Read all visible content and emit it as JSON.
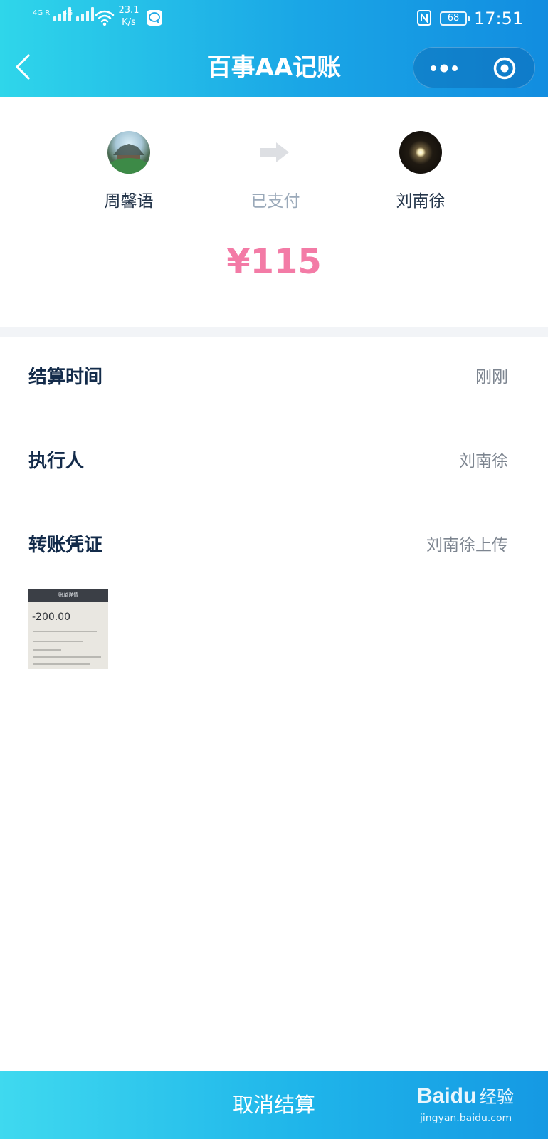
{
  "status_bar": {
    "signal_1_label": "4G R",
    "signal_2_label": "4G",
    "net_speed_value": "23.1",
    "net_speed_unit": "K/s",
    "battery": "68",
    "time": "17:51"
  },
  "nav": {
    "title": "百事AA记账"
  },
  "transfer": {
    "payer_name": "周馨语",
    "status": "已支付",
    "payee_name": "刘南徐",
    "amount": "¥115"
  },
  "details": [
    {
      "label": "结算时间",
      "value": "刚刚"
    },
    {
      "label": "执行人",
      "value": "刘南徐"
    },
    {
      "label": "转账凭证",
      "value": "刘南徐上传"
    }
  ],
  "voucher_thumbnail": {
    "header_text": "账单详情",
    "amount": "-200.00"
  },
  "bottom": {
    "cancel_label": "取消结算"
  },
  "watermark": {
    "brand": "Baidu",
    "product": "经验",
    "url": "jingyan.baidu.com"
  },
  "colors": {
    "header_gradient_start": "#2fd6ea",
    "header_gradient_end": "#128de0",
    "amount_pink": "#f37ba6",
    "label_navy": "#132b4a",
    "value_gray": "#7d8590"
  },
  "icons": [
    "back-arrow-icon",
    "more-dots-icon",
    "close-target-icon",
    "transfer-arrow-icon",
    "nfc-icon",
    "wifi-icon",
    "chat-notification-icon"
  ]
}
